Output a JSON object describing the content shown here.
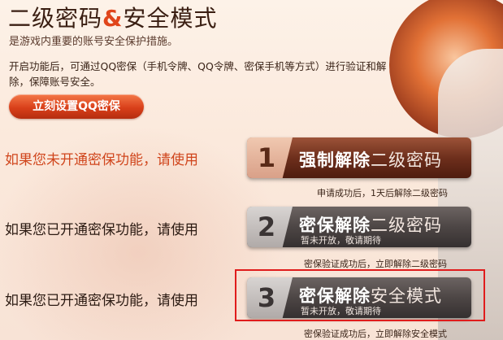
{
  "header": {
    "title_part1": "二级密码",
    "title_amp": "&",
    "title_part2": "安全模式",
    "subtitle": "是游戏内重要的账号安全保护措施。",
    "description": "开启功能后，可通过QQ密保（手机令牌、QQ令牌、密保手机等方式）进行验证和解除，保障账号安全。",
    "setup_button": "立刻设置QQ密保"
  },
  "options": [
    {
      "label": "如果您未开通密保功能，请使用",
      "number": "1",
      "title_bold": "强制解除",
      "title_light": "二级密码",
      "subtitle": "",
      "note": "申请成功后，1天后解除二级密码"
    },
    {
      "label": "如果您已开通密保功能，请使用",
      "number": "2",
      "title_bold": "密保解除",
      "title_light": "二级密码",
      "subtitle": "暂未开放，敬请期待",
      "note": "密保验证成功后，立即解除二级密码"
    },
    {
      "label": "如果您已开通密保功能，请使用",
      "number": "3",
      "title_bold": "密保解除",
      "title_light": "安全模式",
      "subtitle": "暂未开放，敬请期待",
      "note": "密保验证成功后，立即解除安全模式"
    }
  ],
  "colors": {
    "accent": "#e0451b",
    "highlight": "#e01c1c",
    "active_button": "#6e2f1c",
    "disabled_button": "#4d4645"
  }
}
